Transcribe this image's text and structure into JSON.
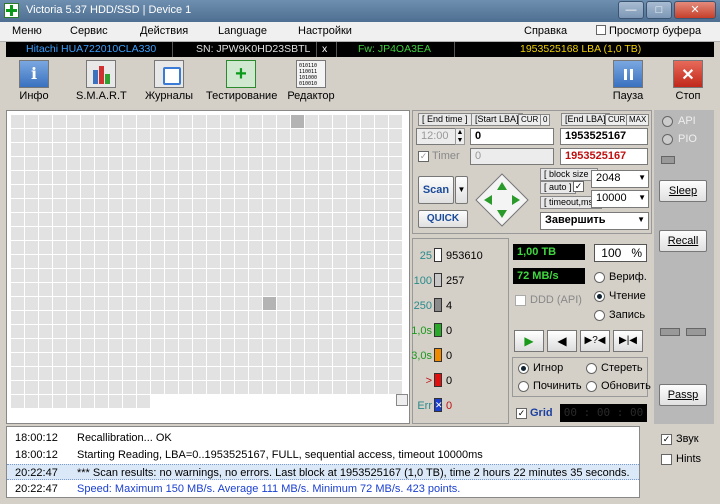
{
  "window": {
    "title": "Victoria 5.37 HDD/SSD | Device 1"
  },
  "menu": {
    "items": [
      "Меню",
      "Сервис",
      "Действия",
      "Language",
      "Настройки"
    ],
    "help": "Справка",
    "buffer": "Просмотр буфера"
  },
  "drive": {
    "model": "Hitachi HUA722010CLA330",
    "serial": "SN: JPW9K0HD23SBTL",
    "x": "x",
    "firmware": "Fw: JP4OA3EA",
    "lba": "1953525168 LBA (1,0 TB)"
  },
  "toolbar": {
    "info": "Инфо",
    "smart": "S.M.A.R.T",
    "journals": "Журналы",
    "testing": "Тестирование",
    "editor": "Редактор",
    "pause": "Пауза",
    "stop": "Стоп"
  },
  "editor_icon_text": "010110\n110011\n101000\n010010",
  "scan": {
    "end_time_label": "[ End time ]",
    "start_lba_label": "[Start LBA]",
    "cur_label": "CUR",
    "zero_label": "0",
    "end_lba_label": "[End LBA]",
    "max_label": "MAX",
    "time_value": "12:00",
    "start_lba": "0",
    "end_lba": "1953525167",
    "timer_label": "Timer",
    "timer_value": "0",
    "end_lba2": "1953525167",
    "scan_button": "Scan",
    "quick_button": "QUICK",
    "block_size_label": "[ block size ]",
    "auto_label": "[ auto ]",
    "block_size": "2048",
    "timeout_label": "[ timeout,ms ]",
    "timeout": "10000",
    "finish_select": "Завершить"
  },
  "stats": [
    {
      "label": "25",
      "count": "953610",
      "color": "#ffffff"
    },
    {
      "label": "100",
      "count": "257",
      "color": "#c8c8c8"
    },
    {
      "label": "250",
      "count": "4",
      "color": "#8a8a8a"
    },
    {
      "label": "1,0s",
      "count": "0",
      "color": "#2aa82a"
    },
    {
      "label": "3,0s",
      "count": "0",
      "color": "#f08a00"
    },
    {
      "label": ">",
      "count": "0",
      "color": "#e01010"
    },
    {
      "label": "Err",
      "count": "0",
      "color": "#1a3fd0"
    }
  ],
  "status": {
    "bytes": "1,00 TB",
    "percent": "100",
    "percent_unit": "%",
    "speed": "72 MB/s",
    "ddd": "DDD (API)"
  },
  "mode": {
    "verify": "Вериф.",
    "read": "Чтение",
    "write": "Запись"
  },
  "action": {
    "ignore": "Игнор",
    "erase": "Стереть",
    "repair": "Починить",
    "refresh": "Обновить"
  },
  "grid": {
    "label": "Grid",
    "timer": "00 : 00 : 00"
  },
  "right": {
    "api": "API",
    "pio": "PIO",
    "sleep": "Sleep",
    "recall": "Recall",
    "passp": "Passp",
    "sound": "Звук",
    "hints": "Hints"
  },
  "log": [
    {
      "time": "18:00:12",
      "text": "Recallibration... OK",
      "style": "normal"
    },
    {
      "time": "18:00:12",
      "text": "Starting Reading, LBA=0..1953525167, FULL, sequential access, timeout 10000ms",
      "style": "normal"
    },
    {
      "time": "20:22:47",
      "text": "*** Scan results: no warnings, no errors. Last block at 1953525167 (1,0 TB), time 2 hours 22 minutes 35 seconds.",
      "style": "sel"
    },
    {
      "time": "20:22:47",
      "text": "Speed: Maximum 150 MB/s. Average 111 MB/s. Minimum 72 MB/s. 423 points.",
      "style": "blue"
    }
  ],
  "map": {
    "cols": 28,
    "full_rows": 20,
    "last_row_blocks": 10,
    "highlight": [
      {
        "row": 0,
        "col": 20
      },
      {
        "row": 13,
        "col": 18
      }
    ]
  }
}
